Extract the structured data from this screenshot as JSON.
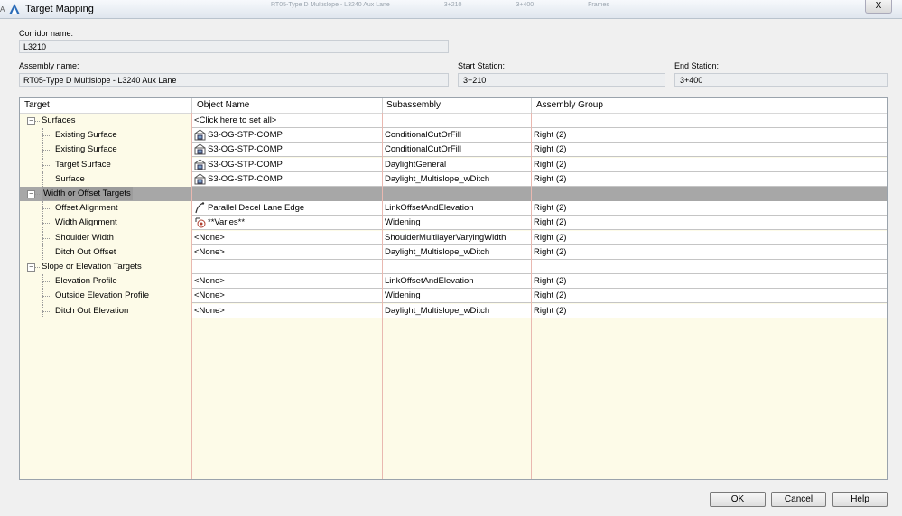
{
  "window": {
    "title": "Target Mapping",
    "background_text": [
      "RT05-Type D Multislope - L3240 Aux Lane",
      "3+210",
      "3+400",
      "Frames"
    ],
    "close_label": "X",
    "edge_text": "A"
  },
  "corridor": {
    "label": "Corridor name:",
    "value": "L3210"
  },
  "assembly": {
    "label": "Assembly name:",
    "value": "RT05-Type D Multislope - L3240 Aux Lane"
  },
  "start_station": {
    "label": "Start Station:",
    "value": "3+210"
  },
  "end_station": {
    "label": "End Station:",
    "value": "3+400"
  },
  "grid": {
    "columns": [
      "Target",
      "Object Name",
      "Subassembly",
      "Assembly Group"
    ],
    "rows": [
      {
        "type": "group",
        "target": "Surfaces",
        "object": "<Click here to set all>",
        "sub": "",
        "group": "",
        "expander": "−"
      },
      {
        "type": "item",
        "target": "Existing Surface",
        "object": "S3-OG-STP-COMP",
        "icon": "surface-icon",
        "sub": "ConditionalCutOrFill",
        "group": "Right (2)"
      },
      {
        "type": "item",
        "target": "Existing Surface",
        "object": "S3-OG-STP-COMP",
        "icon": "surface-icon",
        "sub": "ConditionalCutOrFill",
        "group": "Right (2)"
      },
      {
        "type": "item",
        "target": "Target Surface",
        "object": "S3-OG-STP-COMP",
        "icon": "surface-icon",
        "sub": "DaylightGeneral",
        "group": "Right (2)"
      },
      {
        "type": "item",
        "target": "Surface",
        "object": "S3-OG-STP-COMP",
        "icon": "surface-icon",
        "sub": "Daylight_Multislope_wDitch",
        "group": "Right (2)"
      },
      {
        "type": "group",
        "target": "Width or Offset Targets",
        "object": "",
        "sub": "",
        "group": "",
        "expander": "−",
        "selected": true
      },
      {
        "type": "item",
        "target": "Offset Alignment",
        "object": "Parallel Decel Lane Edge",
        "icon": "alignment-icon",
        "sub": "LinkOffsetAndElevation",
        "group": "Right (2)"
      },
      {
        "type": "item",
        "target": "Width Alignment",
        "object": "**Varies**",
        "icon": "varies-icon",
        "sub": "Widening",
        "group": "Right (2)"
      },
      {
        "type": "item",
        "target": "Shoulder Width",
        "object": "<None>",
        "sub": "ShoulderMultilayerVaryingWidth",
        "group": "Right (2)"
      },
      {
        "type": "item",
        "target": "Ditch Out Offset",
        "object": "<None>",
        "sub": "Daylight_Multislope_wDitch",
        "group": "Right (2)"
      },
      {
        "type": "group",
        "target": "Slope or Elevation Targets",
        "object": "",
        "sub": "",
        "group": "",
        "expander": "−"
      },
      {
        "type": "item",
        "target": "Elevation Profile",
        "object": "<None>",
        "sub": "LinkOffsetAndElevation",
        "group": "Right (2)"
      },
      {
        "type": "item",
        "target": "Outside Elevation Profile",
        "object": "<None>",
        "sub": "Widening",
        "group": "Right (2)"
      },
      {
        "type": "item",
        "target": "Ditch Out Elevation",
        "object": "<None>",
        "sub": "Daylight_Multislope_wDitch",
        "group": "Right (2)"
      }
    ]
  },
  "buttons": {
    "ok": "OK",
    "cancel": "Cancel",
    "help": "Help"
  }
}
